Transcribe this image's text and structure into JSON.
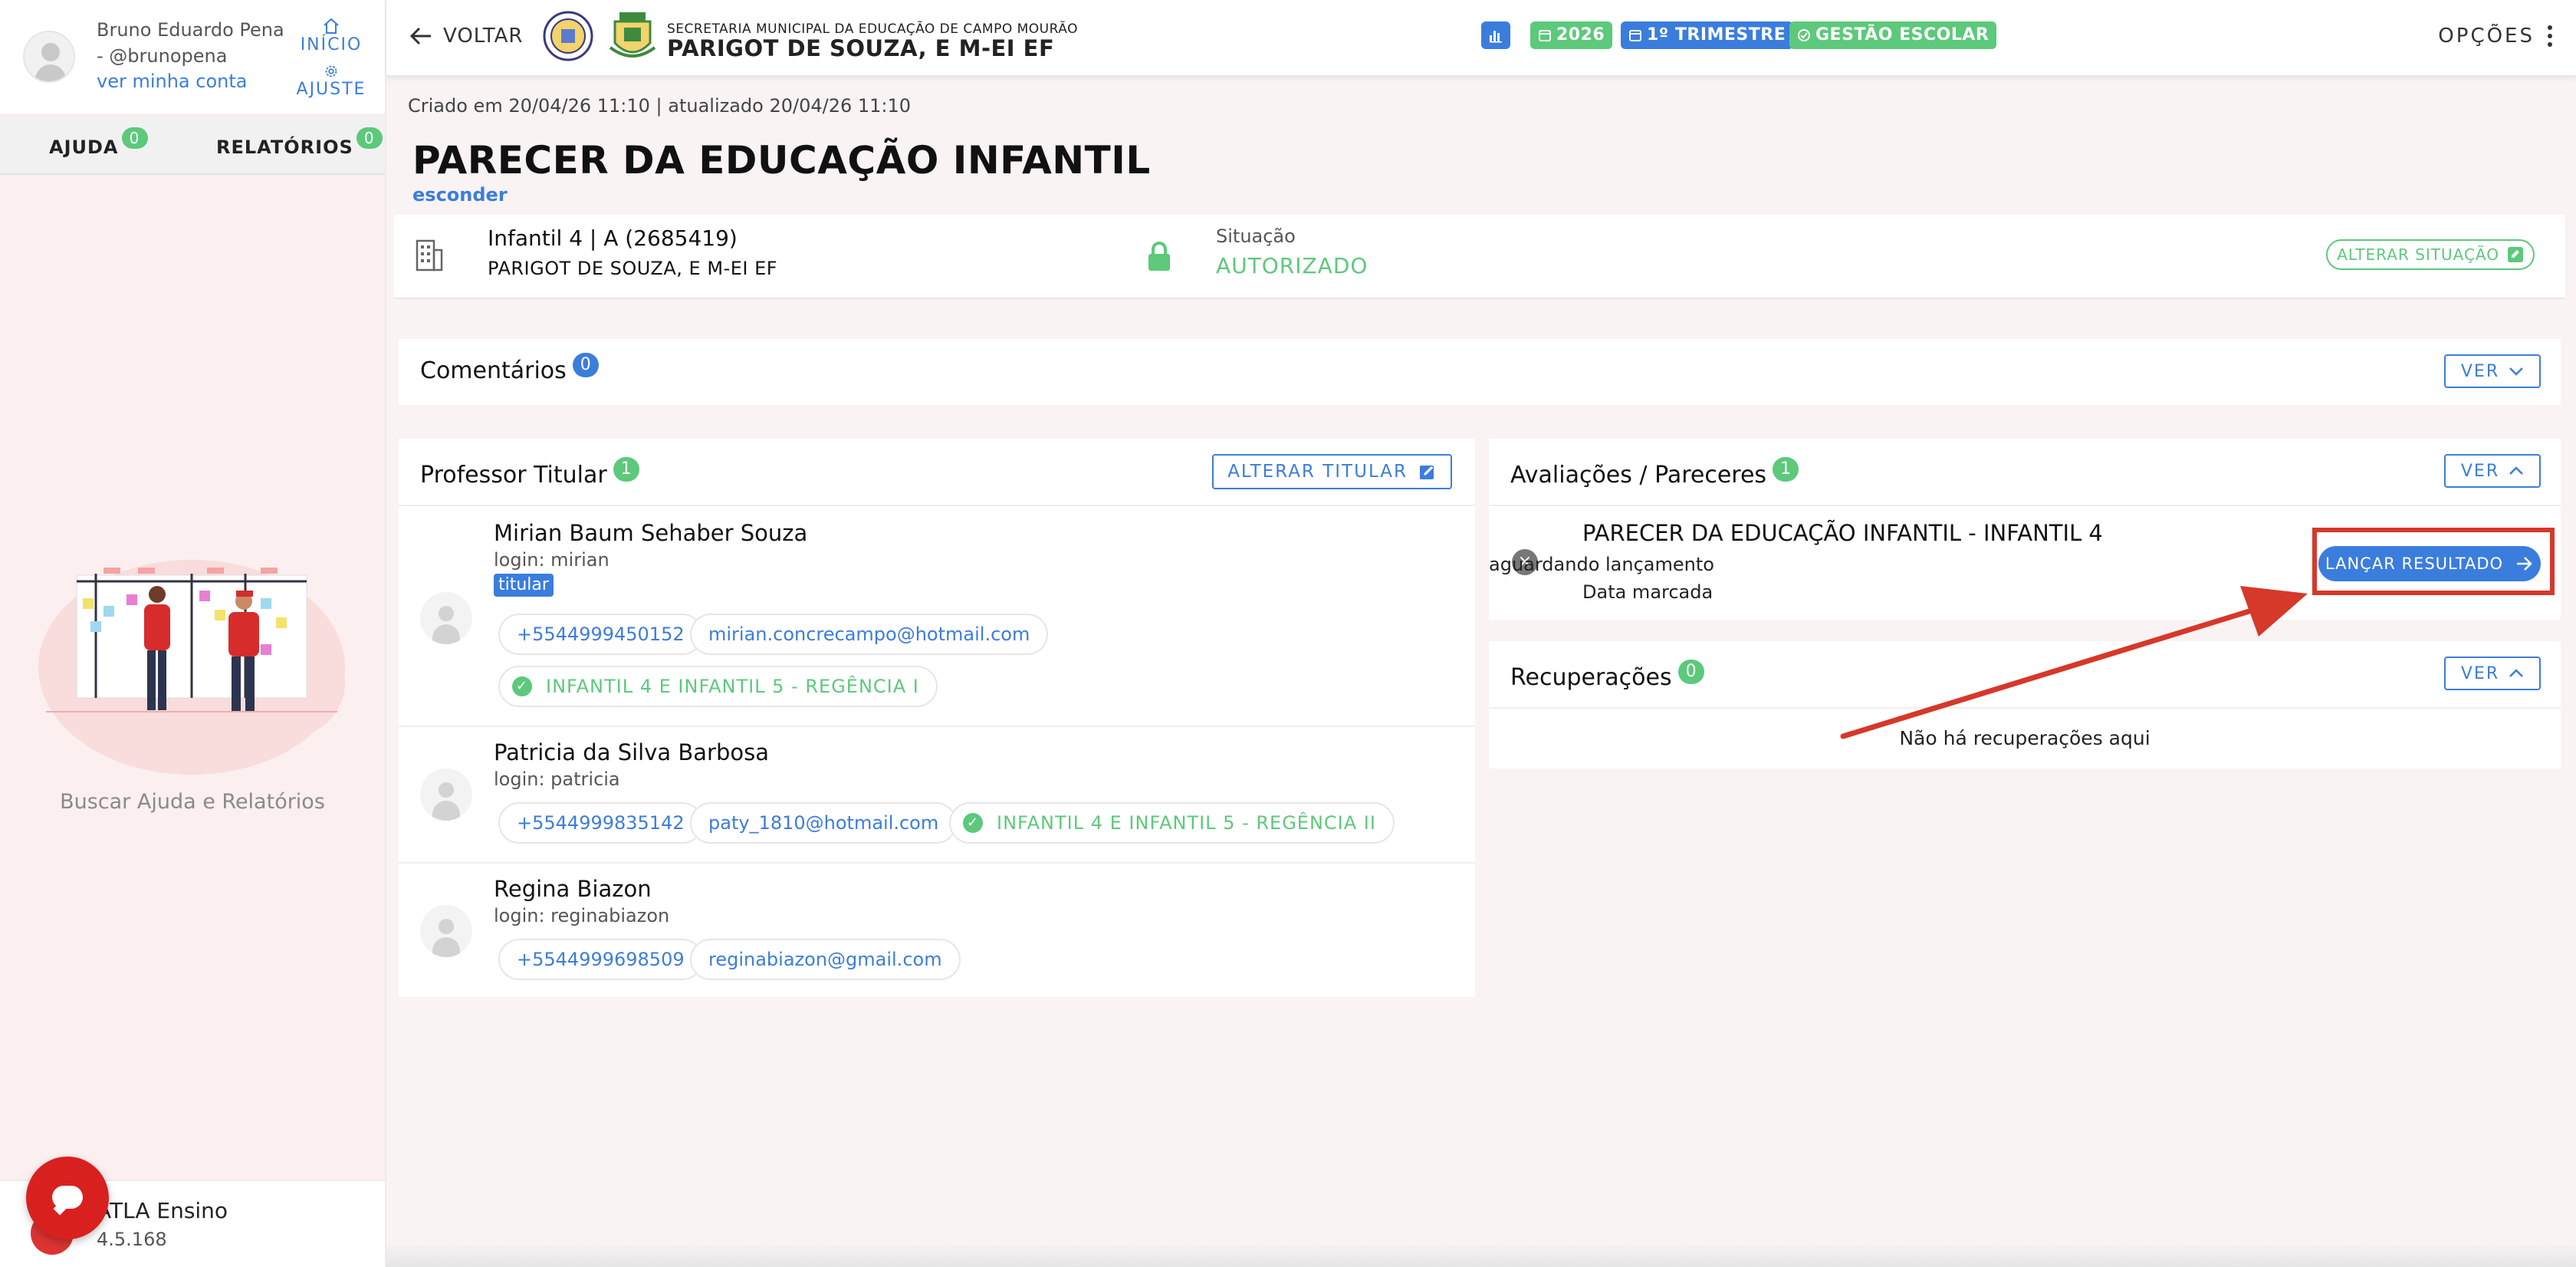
{
  "sidebar": {
    "user_name": "Bruno Eduardo Pena - @brunopena",
    "user_link": "ver minha conta",
    "nav_home": "INÍCIO",
    "nav_settings": "AJUSTE",
    "tabs": [
      {
        "label": "AJUDA",
        "count": "0"
      },
      {
        "label": "RELATÓRIOS",
        "count": "0"
      }
    ],
    "help_text": "Buscar Ajuda e Relatórios",
    "app_name": "ATLA Ensino",
    "app_version": "4.5.168"
  },
  "topbar": {
    "back_label": "VOLTAR",
    "secretaria": "SECRETARIA MUNICIPAL DA EDUCAÇÃO DE CAMPO MOURÃO",
    "school": "PARIGOT DE SOUZA, E M-EI EF",
    "badges": {
      "year": "2026",
      "term": "1º TRIMESTRE",
      "gestao": "GESTÃO ESCOLAR"
    },
    "options_label": "OPÇÕES"
  },
  "main": {
    "created_line": "Criado em 20/04/26 11:10 | atualizado 20/04/26 11:10",
    "title": "PARECER DA EDUCAÇÃO INFANTIL",
    "hide_link": "esconder",
    "class_name": "Infantil 4 | A (2685419)",
    "class_school": "PARIGOT DE SOUZA, E M-EI EF",
    "status_label": "Situação",
    "status_value": "AUTORIZADO",
    "change_status": "ALTERAR SITUAÇÃO",
    "comments": {
      "title": "Comentários",
      "count": "0",
      "ver": "VER"
    },
    "professors": {
      "title": "Professor Titular",
      "count": "1",
      "alter_button": "ALTERAR TITULAR",
      "list": [
        {
          "name": "Mirian Baum Sehaber Souza",
          "login": "login: mirian",
          "tag": "titular",
          "phone": "+5544999450152",
          "email": "mirian.concrecampo@hotmail.com",
          "class": "INFANTIL 4 E INFANTIL 5 - REGÊNCIA I"
        },
        {
          "name": "Patricia da Silva Barbosa",
          "login": "login: patricia",
          "phone": "+5544999835142",
          "email": "paty_1810@hotmail.com",
          "class": "INFANTIL 4 E INFANTIL 5 - REGÊNCIA II"
        },
        {
          "name": "Regina Biazon",
          "login": "login: reginabiazon",
          "phone": "+5544999698509",
          "email": "reginabiazon@gmail.com"
        }
      ]
    },
    "evaluations": {
      "title": "Avaliações / Pareceres",
      "count": "1",
      "ver": "VER",
      "item": {
        "title": "PARECER DA EDUCAÇÃO INFANTIL - INFANTIL 4",
        "status": "aguardando lançamento",
        "date": "Data marcada",
        "action": "LANÇAR RESULTADO"
      }
    },
    "recoveries": {
      "title": "Recuperações",
      "count": "0",
      "ver": "VER",
      "empty": "Não há recuperações aqui"
    }
  },
  "colors": {
    "accent_blue": "#3b7ddd",
    "accent_green": "#5cc97b",
    "annotation_red": "#d6382a"
  }
}
